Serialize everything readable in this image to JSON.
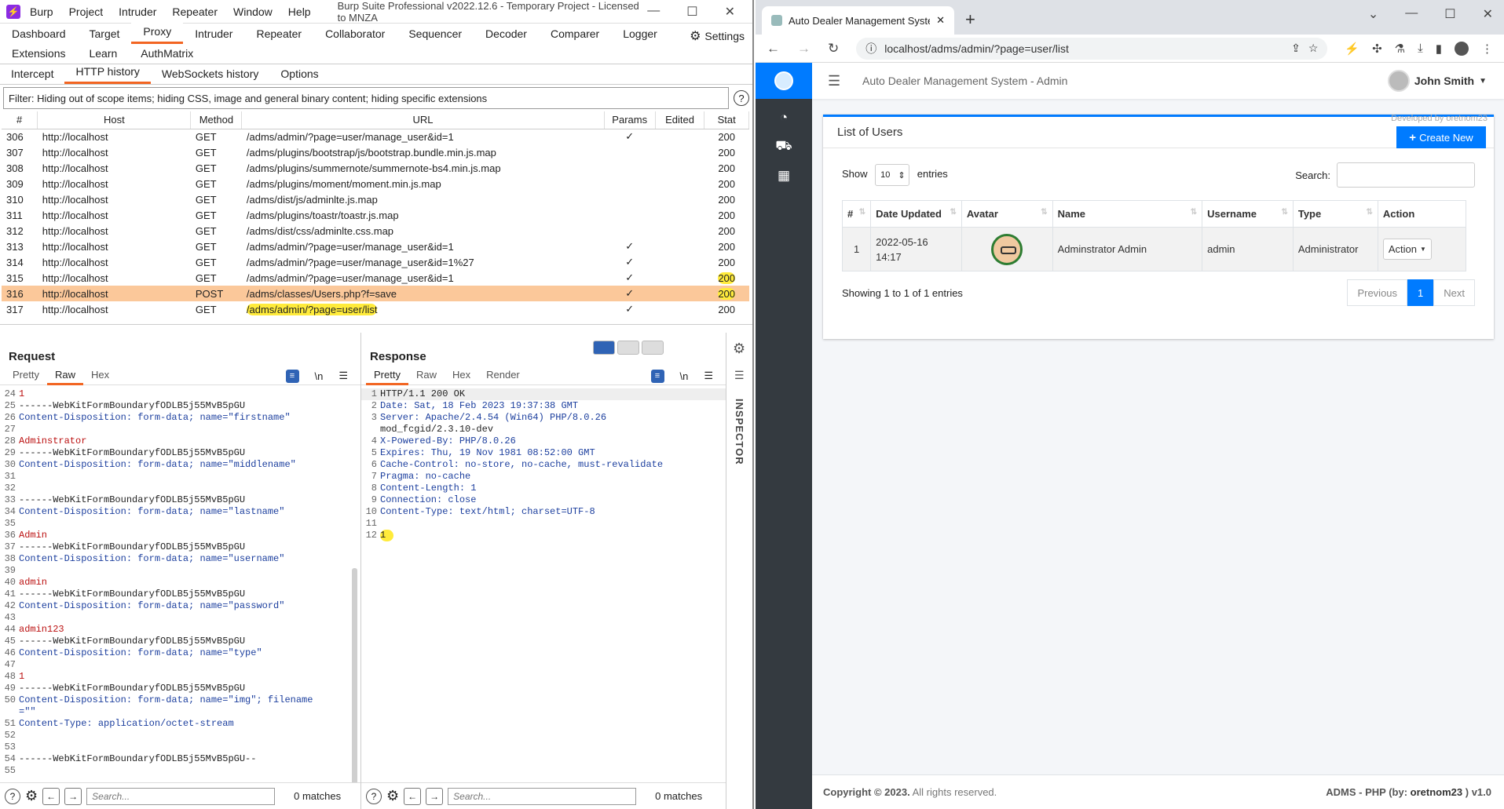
{
  "burp": {
    "logo": "⚡",
    "menu": [
      "Burp",
      "Project",
      "Intruder",
      "Repeater",
      "Window",
      "Help"
    ],
    "title": "Burp Suite Professional v2022.12.6 - Temporary Project - Licensed to MNZA",
    "top_tabs_row1": [
      "Dashboard",
      "Target",
      "Proxy",
      "Intruder",
      "Repeater",
      "Collaborator",
      "Sequencer",
      "Decoder",
      "Comparer",
      "Logger"
    ],
    "settings_label": "Settings",
    "top_tabs_row2": [
      "Extensions",
      "Learn",
      "AuthMatrix"
    ],
    "active_tab": "Proxy",
    "sub_tabs": [
      "Intercept",
      "HTTP history",
      "WebSockets history",
      "Options"
    ],
    "active_sub_tab": "HTTP history",
    "filter": "Filter: Hiding out of scope items;  hiding CSS, image and general binary content;  hiding specific extensions",
    "columns": [
      "#",
      "Host",
      "Method",
      "URL",
      "Params",
      "Edited",
      "Stat"
    ],
    "rows": [
      {
        "n": "306",
        "host": "http://localhost",
        "method": "GET",
        "url": "/adms/admin/?page=user/manage_user&id=1",
        "params": "✓",
        "edited": "",
        "status": "200"
      },
      {
        "n": "307",
        "host": "http://localhost",
        "method": "GET",
        "url": "/adms/plugins/bootstrap/js/bootstrap.bundle.min.js.map",
        "params": "",
        "edited": "",
        "status": "200"
      },
      {
        "n": "308",
        "host": "http://localhost",
        "method": "GET",
        "url": "/adms/plugins/summernote/summernote-bs4.min.js.map",
        "params": "",
        "edited": "",
        "status": "200"
      },
      {
        "n": "309",
        "host": "http://localhost",
        "method": "GET",
        "url": "/adms/plugins/moment/moment.min.js.map",
        "params": "",
        "edited": "",
        "status": "200"
      },
      {
        "n": "310",
        "host": "http://localhost",
        "method": "GET",
        "url": "/adms/dist/js/adminlte.js.map",
        "params": "",
        "edited": "",
        "status": "200"
      },
      {
        "n": "311",
        "host": "http://localhost",
        "method": "GET",
        "url": "/adms/plugins/toastr/toastr.js.map",
        "params": "",
        "edited": "",
        "status": "200"
      },
      {
        "n": "312",
        "host": "http://localhost",
        "method": "GET",
        "url": "/adms/dist/css/adminlte.css.map",
        "params": "",
        "edited": "",
        "status": "200"
      },
      {
        "n": "313",
        "host": "http://localhost",
        "method": "GET",
        "url": "/adms/admin/?page=user/manage_user&id=1",
        "params": "✓",
        "edited": "",
        "status": "200"
      },
      {
        "n": "314",
        "host": "http://localhost",
        "method": "GET",
        "url": "/adms/admin/?page=user/manage_user&id=1%27",
        "params": "✓",
        "edited": "",
        "status": "200"
      },
      {
        "n": "315",
        "host": "http://localhost",
        "method": "GET",
        "url": "/adms/admin/?page=user/manage_user&id=1",
        "params": "✓",
        "edited": "",
        "status": "200"
      },
      {
        "n": "316",
        "host": "http://localhost",
        "method": "POST",
        "url": "/adms/classes/Users.php?f=save",
        "params": "✓",
        "edited": "",
        "status": "200"
      },
      {
        "n": "317",
        "host": "http://localhost",
        "method": "GET",
        "url": "/adms/admin/?page=user/list",
        "params": "✓",
        "edited": "",
        "status": "200"
      }
    ],
    "request": {
      "title": "Request",
      "tabs": [
        "Pretty",
        "Raw",
        "Hex"
      ],
      "active": "Raw",
      "wrap_icon": "\\n",
      "lines": [
        {
          "n": "24",
          "t": "1",
          "k": "val"
        },
        {
          "n": "25",
          "t": "------WebKitFormBoundaryfODLB5j55MvB5pGU",
          "k": ""
        },
        {
          "n": "26",
          "t": "Content-Disposition: form-data; name=\"firstname\"",
          "k": "cd"
        },
        {
          "n": "27",
          "t": "",
          "k": ""
        },
        {
          "n": "28",
          "t": "Adminstrator",
          "k": "val"
        },
        {
          "n": "29",
          "t": "------WebKitFormBoundaryfODLB5j55MvB5pGU",
          "k": ""
        },
        {
          "n": "30",
          "t": "Content-Disposition: form-data; name=\"middlename\"",
          "k": "cd"
        },
        {
          "n": "31",
          "t": "",
          "k": ""
        },
        {
          "n": "32",
          "t": "",
          "k": ""
        },
        {
          "n": "33",
          "t": "------WebKitFormBoundaryfODLB5j55MvB5pGU",
          "k": ""
        },
        {
          "n": "34",
          "t": "Content-Disposition: form-data; name=\"lastname\"",
          "k": "cd"
        },
        {
          "n": "35",
          "t": "",
          "k": ""
        },
        {
          "n": "36",
          "t": "Admin",
          "k": "val"
        },
        {
          "n": "37",
          "t": "------WebKitFormBoundaryfODLB5j55MvB5pGU",
          "k": ""
        },
        {
          "n": "38",
          "t": "Content-Disposition: form-data; name=\"username\"",
          "k": "cd"
        },
        {
          "n": "39",
          "t": "",
          "k": ""
        },
        {
          "n": "40",
          "t": "admin",
          "k": "val"
        },
        {
          "n": "41",
          "t": "------WebKitFormBoundaryfODLB5j55MvB5pGU",
          "k": ""
        },
        {
          "n": "42",
          "t": "Content-Disposition: form-data; name=\"password\"",
          "k": "cd"
        },
        {
          "n": "43",
          "t": "",
          "k": ""
        },
        {
          "n": "44",
          "t": "admin123",
          "k": "val"
        },
        {
          "n": "45",
          "t": "------WebKitFormBoundaryfODLB5j55MvB5pGU",
          "k": ""
        },
        {
          "n": "46",
          "t": "Content-Disposition: form-data; name=\"type\"",
          "k": "cd"
        },
        {
          "n": "47",
          "t": "",
          "k": ""
        },
        {
          "n": "48",
          "t": "1",
          "k": "val"
        },
        {
          "n": "49",
          "t": "------WebKitFormBoundaryfODLB5j55MvB5pGU",
          "k": ""
        },
        {
          "n": "50",
          "t": "Content-Disposition: form-data; name=\"img\"; filename",
          "k": "cd"
        },
        {
          "n": "",
          "t": "=\"\"",
          "k": "str"
        },
        {
          "n": "51",
          "t": "Content-Type: application/octet-stream",
          "k": "cd"
        },
        {
          "n": "52",
          "t": "",
          "k": ""
        },
        {
          "n": "53",
          "t": "",
          "k": ""
        },
        {
          "n": "54",
          "t": "------WebKitFormBoundaryfODLB5j55MvB5pGU--",
          "k": ""
        },
        {
          "n": "55",
          "t": "",
          "k": ""
        }
      ]
    },
    "response": {
      "title": "Response",
      "tabs": [
        "Pretty",
        "Raw",
        "Hex",
        "Render"
      ],
      "active": "Pretty",
      "wrap_icon": "\\n",
      "lines": [
        {
          "n": "1",
          "t": "HTTP/1.1 200 OK",
          "k": ""
        },
        {
          "n": "2",
          "t": "Date: Sat, 18 Feb 2023 19:37:38 GMT",
          "k": "h"
        },
        {
          "n": "3",
          "t": "Server: Apache/2.4.54 (Win64) PHP/8.0.26",
          "k": "h"
        },
        {
          "n": "",
          "t": "mod_fcgid/2.3.10-dev",
          "k": ""
        },
        {
          "n": "4",
          "t": "X-Powered-By: PHP/8.0.26",
          "k": "h"
        },
        {
          "n": "5",
          "t": "Expires: Thu, 19 Nov 1981 08:52:00 GMT",
          "k": "h"
        },
        {
          "n": "6",
          "t": "Cache-Control: no-store, no-cache, must-revalidate",
          "k": "h"
        },
        {
          "n": "7",
          "t": "Pragma: no-cache",
          "k": "h"
        },
        {
          "n": "8",
          "t": "Content-Length: 1",
          "k": "h"
        },
        {
          "n": "9",
          "t": "Connection: close",
          "k": "h"
        },
        {
          "n": "10",
          "t": "Content-Type: text/html; charset=UTF-8",
          "k": "h"
        },
        {
          "n": "11",
          "t": "",
          "k": ""
        },
        {
          "n": "12",
          "t": "1",
          "k": "hl"
        }
      ]
    },
    "inspector_label": "INSPECTOR",
    "search_placeholder": "Search...",
    "matches": "0 matches"
  },
  "browser": {
    "tab_title": "Auto Dealer Management System",
    "close_tab": "✕",
    "new_tab": "+",
    "url": "localhost/adms/admin/?page=user/list",
    "app": {
      "title": "Auto Dealer Management System - Admin",
      "user_name": "John Smith",
      "card_title": "List of Users",
      "developed_by": "Developed by oretnom23",
      "create_label": "Create New",
      "show_label": "Show",
      "entries_value": "10",
      "entries_label": "entries",
      "search_label": "Search:",
      "columns": [
        "#",
        "Date Updated",
        "Avatar",
        "Name",
        "Username",
        "Type",
        "Action"
      ],
      "user_row": {
        "n": "1",
        "date": "2022-05-16",
        "time": "14:17",
        "name": "Adminstrator Admin",
        "username": "admin",
        "type": "Administrator",
        "action": "Action"
      },
      "showing": "Showing 1 to 1 of 1 entries",
      "pager": [
        "Previous",
        "1",
        "Next"
      ],
      "footer_left_prefix": "Copyright © 2023.",
      "footer_left_suffix": "All rights reserved.",
      "footer_right_prefix": "ADMS - PHP (by:",
      "footer_right_author": "oretnom23",
      "footer_right_suffix": ") v1.0"
    }
  }
}
